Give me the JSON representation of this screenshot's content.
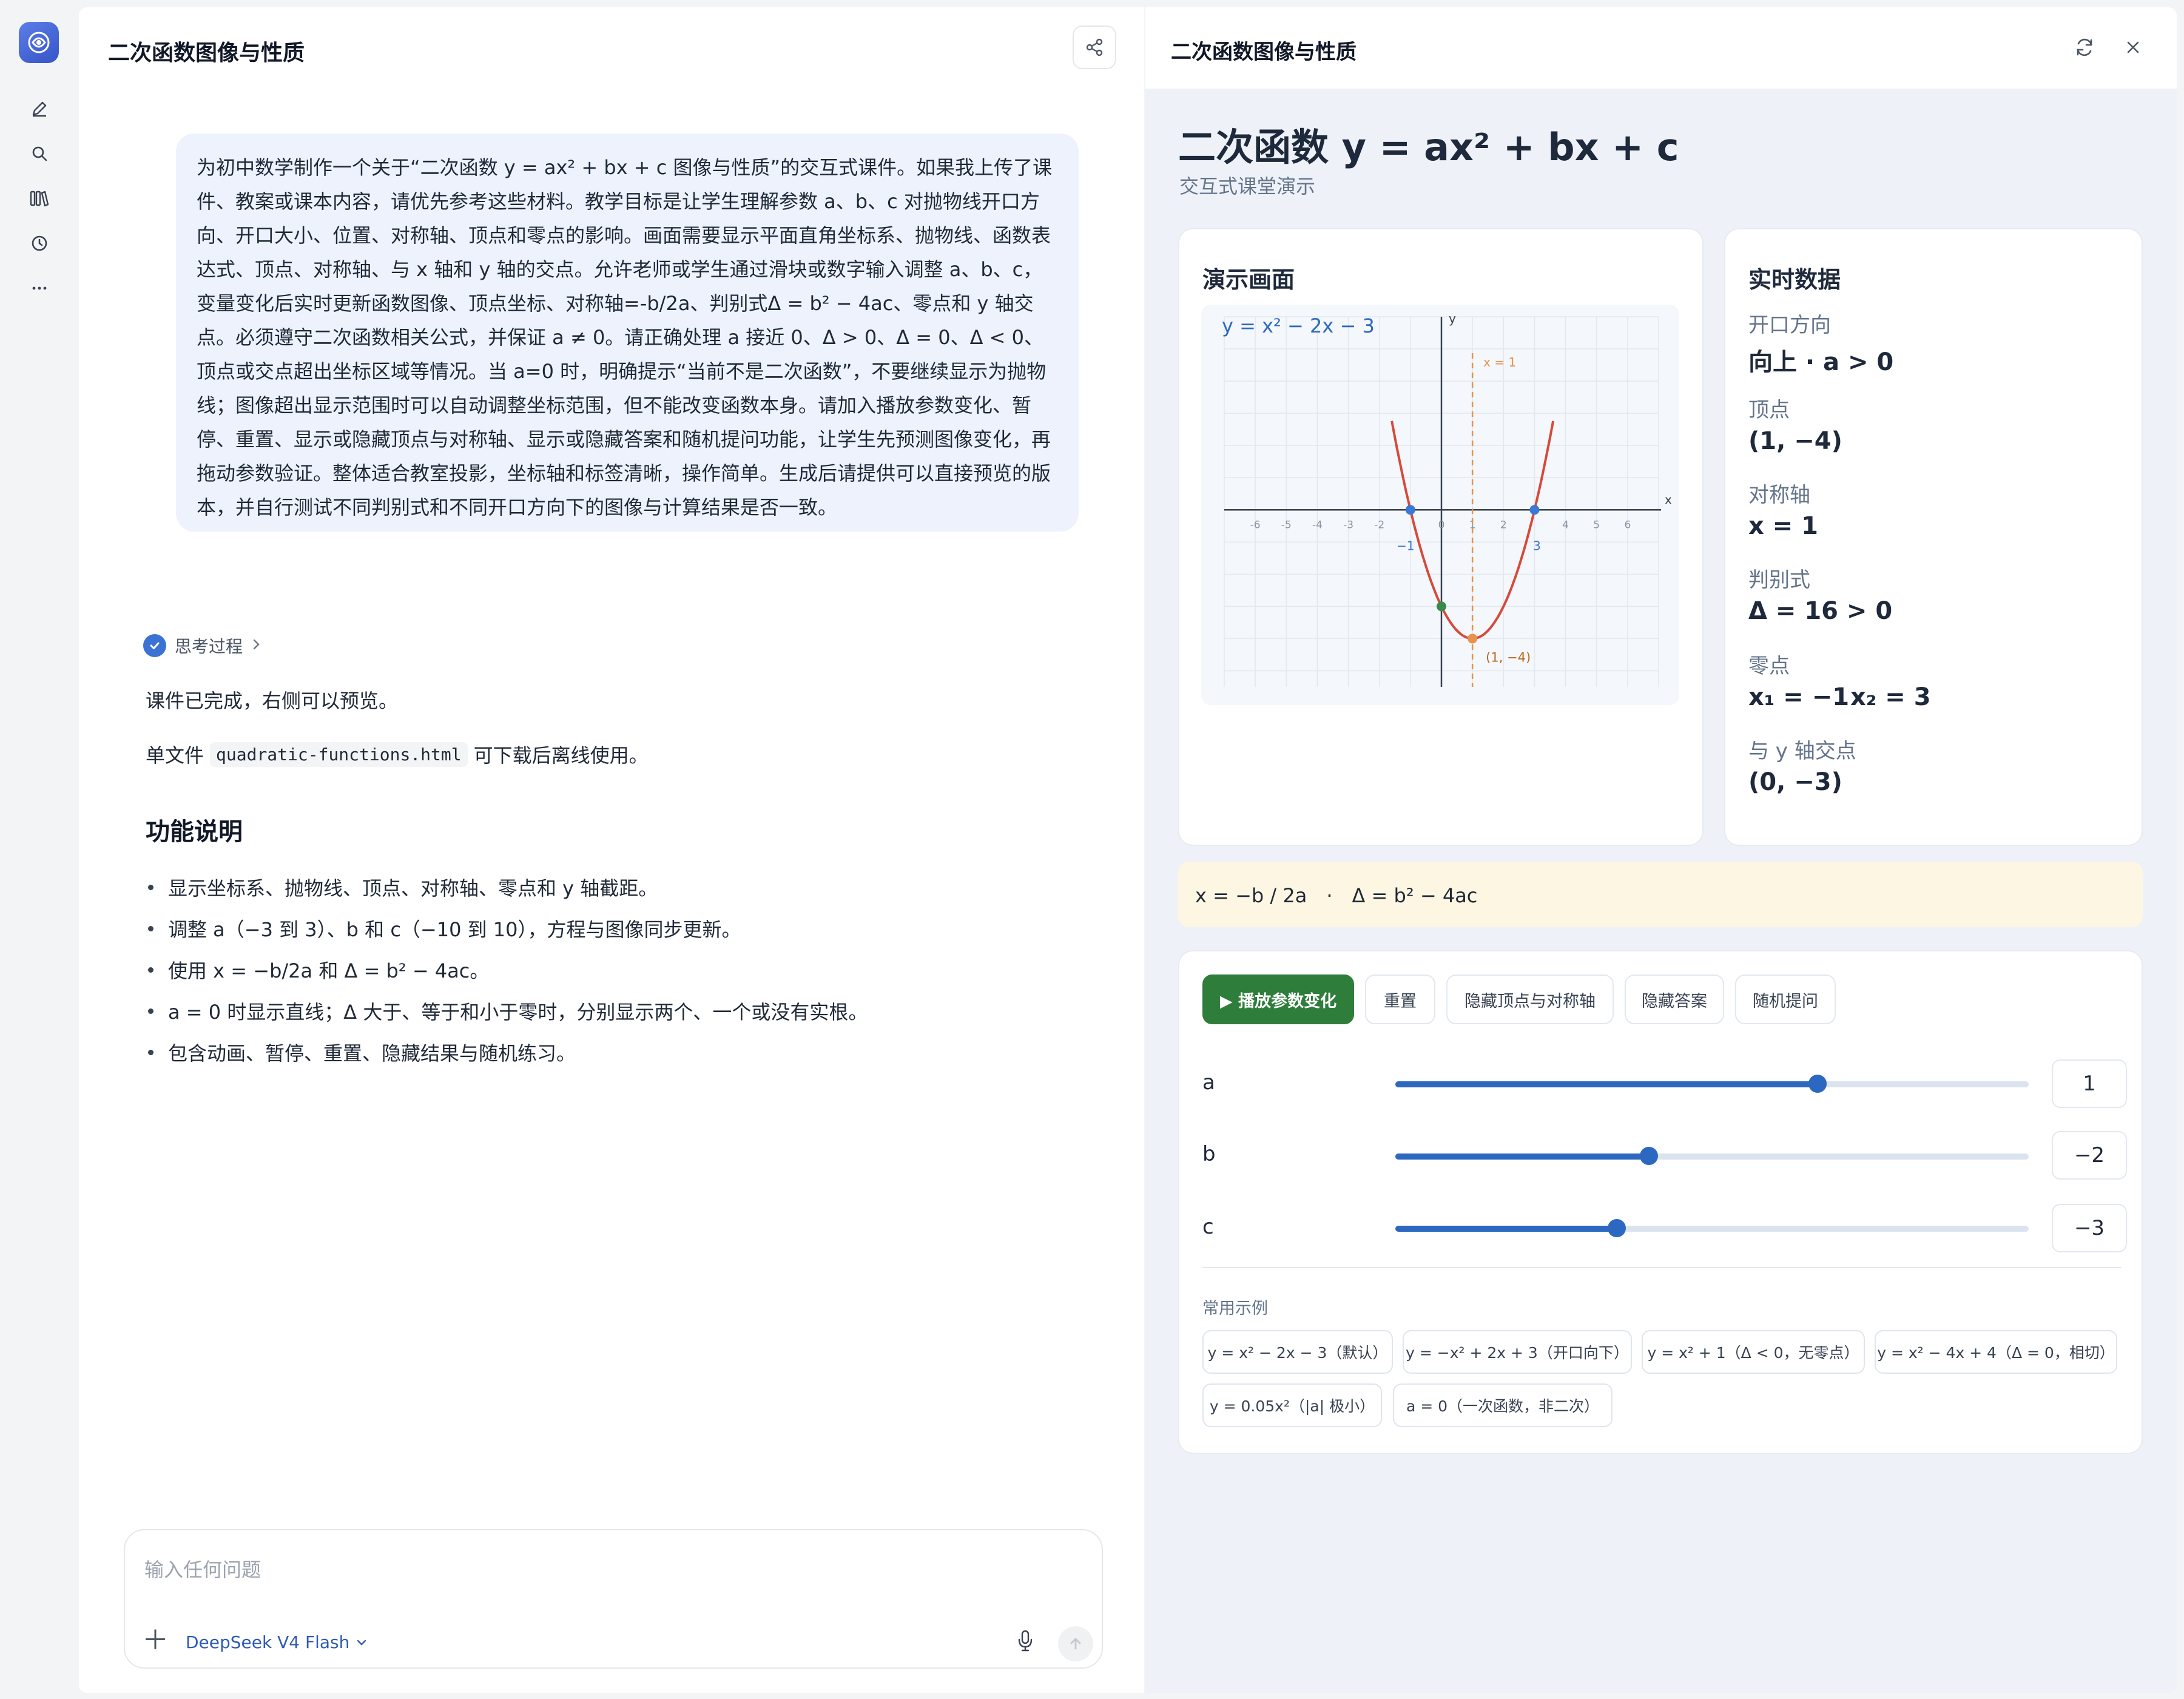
{
  "chat": {
    "title": "二次函数图像与性质",
    "user_message": "为初中数学制作一个关于“二次函数 y = ax² + bx + c 图像与性质”的交互式课件。如果我上传了课件、教案或课本内容，请优先参考这些材料。教学目标是让学生理解参数 a、b、c 对抛物线开口方向、开口大小、位置、对称轴、顶点和零点的影响。画面需要显示平面直角坐标系、抛物线、函数表达式、顶点、对称轴、与 x 轴和 y 轴的交点。允许老师或学生通过滑块或数字输入调整 a、b、c，变量变化后实时更新函数图像、顶点坐标、对称轴=-b/2a、判别式Δ = b² − 4ac、零点和 y 轴交点。必须遵守二次函数相关公式，并保证 a ≠ 0。请正确处理 a 接近 0、Δ > 0、Δ = 0、Δ < 0、顶点或交点超出坐标区域等情况。当 a=0 时，明确提示“当前不是二次函数”，不要继续显示为抛物线；图像超出显示范围时可以自动调整坐标范围，但不能改变函数本身。请加入播放参数变化、暂停、重置、显示或隐藏顶点与对称轴、显示或隐藏答案和随机提问功能，让学生先预测图像变化，再拖动参数验证。整体适合教室投影，坐标轴和标签清晰，操作简单。生成后请提供可以直接预览的版本，并自行测试不同判别式和不同开口方向下的图像与计算结果是否一致。",
    "thinking_label": "思考过程",
    "done_text": "课件已完成，右侧可以预览。",
    "file_prefix": "单文件",
    "file_name": "quadratic-functions.html",
    "file_suffix": "可下载后离线使用。",
    "features_title": "功能说明",
    "features": [
      "显示坐标系、抛物线、顶点、对称轴、零点和 y 轴截距。",
      "调整 a（−3 到 3）、b 和 c（−10 到 10），方程与图像同步更新。",
      "使用 x = −b/2a 和 Δ = b² − 4ac。",
      "a = 0 时显示直线；Δ 大于、等于和小于零时，分别显示两个、一个或没有实根。",
      "包含动画、暂停、重置、隐藏结果与随机练习。"
    ],
    "input_placeholder": "输入任何问题",
    "model_name": "DeepSeek V4 Flash"
  },
  "preview": {
    "title": "二次函数图像与性质",
    "heading": "二次函数 y = ax² + bx + c",
    "subheading": "交互式课堂演示",
    "demo_title": "演示画面",
    "data_title": "实时数据",
    "data": {
      "direction_label": "开口方向",
      "direction_value": "向上 · a > 0",
      "vertex_label": "顶点",
      "vertex_value": "(1, −4)",
      "axis_label": "对称轴",
      "axis_value": "x = 1",
      "disc_label": "判别式",
      "disc_value": "Δ = 16 > 0",
      "zeros_label": "零点",
      "zero1_value": "x₁ = −1",
      "zero2_value": "x₂ = 3",
      "yint_label": "与 y 轴交点",
      "yint_value": "(0, −3)"
    },
    "formula_text": "x = −b / 2a　·　Δ = b² − 4ac",
    "buttons": {
      "play": "▶ 播放参数变化",
      "reset": "重置",
      "toggle_vertex": "隐藏顶点与对称轴",
      "toggle_answer": "隐藏答案",
      "random": "随机提问"
    },
    "sliders": [
      {
        "label": "a",
        "value": "1",
        "fraction": 0.667
      },
      {
        "label": "b",
        "value": "−2",
        "fraction": 0.4
      },
      {
        "label": "c",
        "value": "−3",
        "fraction": 0.35
      }
    ],
    "examples_title": "常用示例",
    "examples": [
      "y = x² − 2x − 3（默认）",
      "y = −x² + 2x + 3（开口向下）",
      "y = x² + 1（Δ < 0，无零点）",
      "y = x² − 4x + 4（Δ = 0，相切）",
      "y = 0.05x²（|a| 极小）",
      "a = 0（一次函数，非二次）"
    ]
  },
  "chart_data": {
    "type": "line",
    "title": "y = x² − 2x − 3",
    "xlabel": "x",
    "ylabel": "y",
    "xlim": [
      -7,
      7
    ],
    "ylim": [
      -5.5,
      6
    ],
    "x_ticks": [
      "-6",
      "-5",
      "-4",
      "-3",
      "-2",
      "-1",
      "0",
      "1",
      "2",
      "3",
      "4",
      "5",
      "6"
    ],
    "a": 1,
    "b": -2,
    "c": -3,
    "x": [
      -1.6,
      -1,
      0,
      1,
      2,
      3,
      3.6
    ],
    "y": [
      2.76,
      0,
      -3,
      -4,
      -3,
      0,
      2.76
    ],
    "axis_of_symmetry_label": "x = 1",
    "axis_of_symmetry_x": 1,
    "vertex_label": "(1, −4)",
    "vertex": [
      1,
      -4
    ],
    "zeros": [
      -1,
      3
    ],
    "zero_labels": [
      "−1",
      "3"
    ],
    "y_intercept": [
      0,
      -3
    ],
    "grid": true,
    "colors": {
      "curve": "#d64a3b",
      "axis_line": "#e8924a",
      "vertex": "#e8924a",
      "zeros": "#3a78d6",
      "y_intercept": "#3a8a4a"
    }
  },
  "colors": {
    "brand": "#3f62d6",
    "primary_button": "#2e7d3b",
    "slider": "#2d68c0",
    "formula_bg": "#fdf6e3",
    "bubble_bg": "#edf2fd"
  },
  "icons": [
    "app-logo-icon",
    "new-chat-icon",
    "search-icon",
    "library-icon",
    "history-icon",
    "more-icon",
    "share-icon",
    "check-icon",
    "chevron-right-icon",
    "plus-icon",
    "chevron-down-icon",
    "mic-icon",
    "send-icon",
    "refresh-icon",
    "close-icon"
  ]
}
